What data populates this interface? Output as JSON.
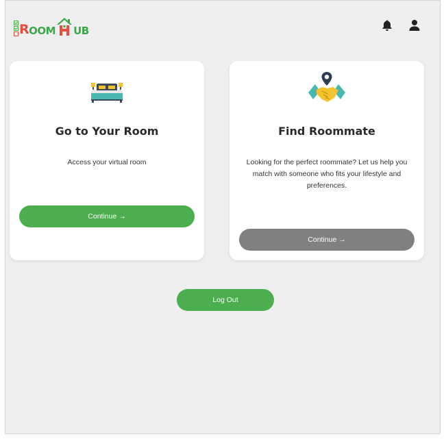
{
  "header": {
    "logo": {
      "text_r": "R",
      "text_oom": "OOM",
      "text_h": "H",
      "text_ub": "UB"
    },
    "icons": [
      "bell-icon",
      "user-icon"
    ]
  },
  "cards": [
    {
      "icon": "bed-icon",
      "title": "Go to Your Room",
      "description": "Access your virtual room",
      "button_label": "Continue →",
      "button_color": "#4cae4f"
    },
    {
      "icon": "handshake-location-icon",
      "title": "Find Roommate",
      "description": "Looking for the perfect roommate? Let us help you match with someone who fits your lifestyle and preferences.",
      "button_label": "Continue →",
      "button_color": "#808080"
    }
  ],
  "logout_label": "Log Out",
  "colors": {
    "accent": "#4cae4f",
    "logo_red": "#e74c3c",
    "logo_green": "#3aa84a",
    "background": "#efefef"
  }
}
